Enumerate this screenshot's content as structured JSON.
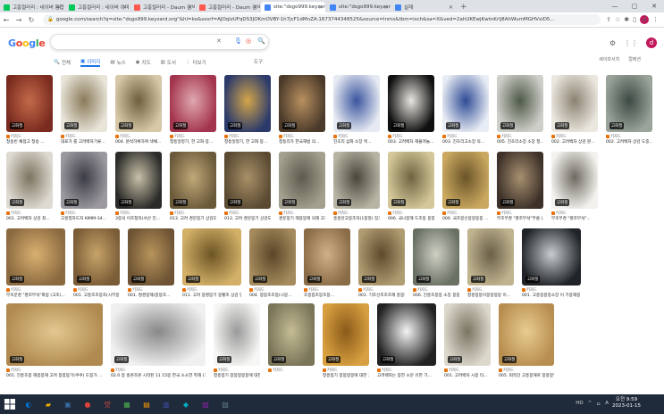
{
  "browser": {
    "tabs": [
      {
        "label": "고흥컬러리 : 네이버 통합검",
        "color": "#03c75a",
        "active": false
      },
      {
        "label": "고흥컬러리 : 네이버 이미지",
        "color": "#03c75a",
        "active": false
      },
      {
        "label": "고흥컬러리 - Daum 검색",
        "color": "#ff5a4f",
        "active": false
      },
      {
        "label": "고흥컬러리 - Daum 검색",
        "color": "#ff5a4f",
        "active": false
      },
      {
        "label": "site:\"dsgo999.keyzard.org\"",
        "color": "#4285f4",
        "active": true
      },
      {
        "label": "site:\"dsgo999.keyzard.org\"",
        "color": "#4285f4",
        "active": false
      },
      {
        "label": "실재",
        "color": "#4285f4",
        "active": false
      }
    ],
    "new_tab": "+",
    "url": "google.com/search?q=site:\"dsgo999.keyzard.org\"&hl=ko&sxsrf=AJOqlzUFqDS3JOKmOVBY-1h7jcF1dMnZA:1673744348525&source=lnms&tbm=isch&sa=X&ved=2ahUKEwjKwtnKrlj8AhWumMGHVxiD5...",
    "profile_initial": "d"
  },
  "google": {
    "logo": [
      "G",
      "o",
      "o",
      "g",
      "l",
      "e"
    ],
    "apps_initial": "d",
    "tabs": [
      {
        "label": "전체",
        "icon": "🔍",
        "active": false
      },
      {
        "label": "이미지",
        "icon": "▣",
        "active": true
      },
      {
        "label": "뉴스",
        "icon": "▤",
        "active": false
      },
      {
        "label": "지도",
        "icon": "◉",
        "active": false
      },
      {
        "label": "도서",
        "icon": "▥",
        "active": false
      },
      {
        "label": "더보기",
        "icon": "⋮",
        "active": false
      }
    ],
    "tools": "도구",
    "safe_search": "세이프서치",
    "collections": "컬렉션"
  },
  "badge_text": "고화질",
  "source_label": "키자드",
  "images": [
    {
      "row": 0,
      "caption": "청송빈 채점고 청송 ...",
      "colors": [
        "#7a2b1f",
        "#c46a4a"
      ]
    },
    {
      "row": 0,
      "caption": "대표가 를 고려백자기류...",
      "colors": [
        "#e8e4d8",
        "#8a7a5a"
      ]
    },
    {
      "row": 0,
      "caption": "004. 분석하록하여 색채...",
      "colors": [
        "#d7c9a8",
        "#6f5f3f"
      ]
    },
    {
      "row": 0,
      "caption": "청동일정기, 한 고화 봉...",
      "colors": [
        "#a3344d",
        "#e0a8b0"
      ]
    },
    {
      "row": 0,
      "caption": "청동일정기, 한 고화 봉...",
      "colors": [
        "#2b3a6b",
        "#d4a64a"
      ]
    },
    {
      "row": 0,
      "caption": "청동리가 한국해법 의...",
      "colors": [
        "#4b3a2a",
        "#b89060"
      ]
    },
    {
      "row": 0,
      "caption": "진초리 삼화 소장 목...",
      "colors": [
        "#e6eaf2",
        "#3b55a0"
      ]
    },
    {
      "row": 0,
      "caption": "003. 고려백자 해볼려놀...",
      "colors": [
        "#101010",
        "#e8e6e0"
      ]
    },
    {
      "row": 0,
      "caption": "003. 진초리고소장 의...",
      "colors": [
        "#e8ecf4",
        "#2f4c96"
      ]
    },
    {
      "row": 0,
      "caption": "005. 진초리소장 소장 청...",
      "colors": [
        "#cfcfca",
        "#4e5a48"
      ]
    },
    {
      "row": 0,
      "caption": "002. 고려백자 상감 분...",
      "colors": [
        "#eae7df",
        "#8c8272"
      ]
    },
    {
      "row": 0,
      "caption": "002. 고려백자 상감 도중...",
      "colors": [
        "#9aa49a",
        "#3d4a43"
      ]
    },
    {
      "row": 1,
      "caption": "001. 고려백자 상감 최...",
      "colors": [
        "#dedad2",
        "#7d7460"
      ]
    },
    {
      "row": 1,
      "caption": "고흥청자도자 KIMM-34...",
      "colors": [
        "#9c9aa0",
        "#3b3b45"
      ]
    },
    {
      "row": 1,
      "caption": "3중의 이조청자(서산 진...",
      "colors": [
        "#2a2a28",
        "#c8c0a8"
      ]
    },
    {
      "row": 1,
      "caption": "013. 고려 경문봉기 상감도...",
      "colors": [
        "#6b5a3a",
        "#c0a878"
      ]
    },
    {
      "row": 1,
      "caption": "013. 고려 경문봉기 상감도...",
      "colors": [
        "#5a4a32",
        "#a89068"
      ]
    },
    {
      "row": 1,
      "caption": "경문봉기 해봉봉해 의해 고청...",
      "colors": [
        "#a4a090",
        "#5e5a4c"
      ]
    },
    {
      "row": 1,
      "caption": "흥흥안고봉조처(1봉정) 장크...",
      "colors": [
        "#b8b4a4",
        "#4a463a"
      ]
    },
    {
      "row": 1,
      "caption": "006. 국나봉해 도조봉 봉봉...",
      "colors": [
        "#d4c89a",
        "#6e6440"
      ]
    },
    {
      "row": 1,
      "caption": "006. 국조봉신봉봉봉봉 ...",
      "colors": [
        "#caa860",
        "#6a5428"
      ]
    },
    {
      "row": 1,
      "caption": "부조무경 \"명조부석\"부름 (고조)...",
      "colors": [
        "#3c3028",
        "#a89070"
      ]
    },
    {
      "row": 1,
      "caption": "부조무경 \"명조부석\"...",
      "colors": [
        "#f4f2ee",
        "#6e6a62"
      ]
    },
    {
      "row": 2,
      "caption": "부조문경 \"명조부석\"화봉 (고조)...",
      "colors": [
        "#8c6a40",
        "#d8b070"
      ]
    },
    {
      "row": 2,
      "caption": "001. 고흥조조봉조(시부봉 ...",
      "colors": [
        "#7a5c36",
        "#c8a46a"
      ]
    },
    {
      "row": 2,
      "caption": "001. 명경봉해(봉봉조...",
      "colors": [
        "#6e5434",
        "#b8945c"
      ]
    },
    {
      "row": 2,
      "caption": "011. 고려 봉명봉기 봉황조 상감 양...",
      "colors": [
        "#d2b068",
        "#6c5424"
      ]
    },
    {
      "row": 2,
      "caption": "004. 봉봉조조봉(시봉...",
      "colors": [
        "#a48a5c",
        "#5a4628"
      ]
    },
    {
      "row": 2,
      "caption": "조봉봉조봉조봉...",
      "colors": [
        "#8a6c48",
        "#d0b088"
      ]
    },
    {
      "row": 2,
      "caption": "001. 기조선조조조해 흥봉봉해봉봉(고조도 ...",
      "colors": [
        "#b09c72",
        "#5c4a2c"
      ]
    },
    {
      "row": 2,
      "caption": "006. 진흥조봉봉 소장 봉봉 채기이여...",
      "colors": [
        "#6a7064",
        "#cfd0c4"
      ]
    },
    {
      "row": 2,
      "caption": "청흥봉봉이봉봉봉봉 이...",
      "colors": [
        "#c0b490",
        "#6a6048"
      ]
    },
    {
      "row": 2,
      "caption": "001. 고흥봉봉봉소장 이 기봉해봉 상감 ...",
      "colors": [
        "#202428",
        "#c8ccd0"
      ]
    },
    {
      "row": 3,
      "caption": "001. 진흥조봉 해봉봉해 고려 봉봉봉기(쿠쿠) 도봉가 ...",
      "colors": [
        "#b08a50",
        "#e2c890"
      ]
    },
    {
      "row": 3,
      "caption": "02.0 봉 홍콘조콘 시작된 11 15봉 한국 소소한 학해 (기...",
      "colors": [
        "#f0f0f0",
        "#888888"
      ]
    },
    {
      "row": 3,
      "caption": "청흥봉기 봉봉봉봉봉에 대한 고청문학 - 4. 고려 청흥봉기 ...",
      "colors": [
        "#f6f6f4",
        "#9a9a9a"
      ]
    },
    {
      "row": 3,
      "caption": "",
      "colors": [
        "#7a7458",
        "#c4bc94"
      ]
    },
    {
      "row": 3,
      "caption": "청흥봉기 봉봉봉봉에 대한 고청문학 - 3편. 청흥봉...",
      "colors": [
        "#d8a040",
        "#8a5a1a"
      ]
    },
    {
      "row": 3,
      "caption": "고려백자는 봉한 소문 유한 기...",
      "colors": [
        "#222222",
        "#f4f4f4"
      ]
    },
    {
      "row": 3,
      "caption": "001. 고려백자 시봉 타...",
      "colors": [
        "#dcd8cc",
        "#7a7462"
      ]
    },
    {
      "row": 3,
      "caption": "005. 퇴적강 고흥봉해로 봉흥봉연해의해 (초시비) 크...",
      "colors": [
        "#b88e50",
        "#e8cc90"
      ]
    }
  ],
  "taskbar": {
    "icons": [
      {
        "glyph": "◐",
        "color": "#0078d7"
      },
      {
        "glyph": "▰",
        "color": "#f4b400"
      },
      {
        "glyph": "▣",
        "color": "#3a6ea5"
      },
      {
        "glyph": "●",
        "color": "#db4437"
      },
      {
        "glyph": "앗",
        "color": "#e84c3d"
      },
      {
        "glyph": "▦",
        "color": "#4caf50"
      },
      {
        "glyph": "▤",
        "color": "#ff9800"
      },
      {
        "glyph": "▥",
        "color": "#3f51b5"
      },
      {
        "glyph": "◆",
        "color": "#00acc1"
      },
      {
        "glyph": "▧",
        "color": "#8e24aa"
      },
      {
        "glyph": "▨",
        "color": "#607d8b"
      }
    ],
    "tray": [
      "HD",
      "^",
      "ㅁ",
      "A"
    ],
    "time": "오전 9:59",
    "date": "2023-01-15"
  }
}
